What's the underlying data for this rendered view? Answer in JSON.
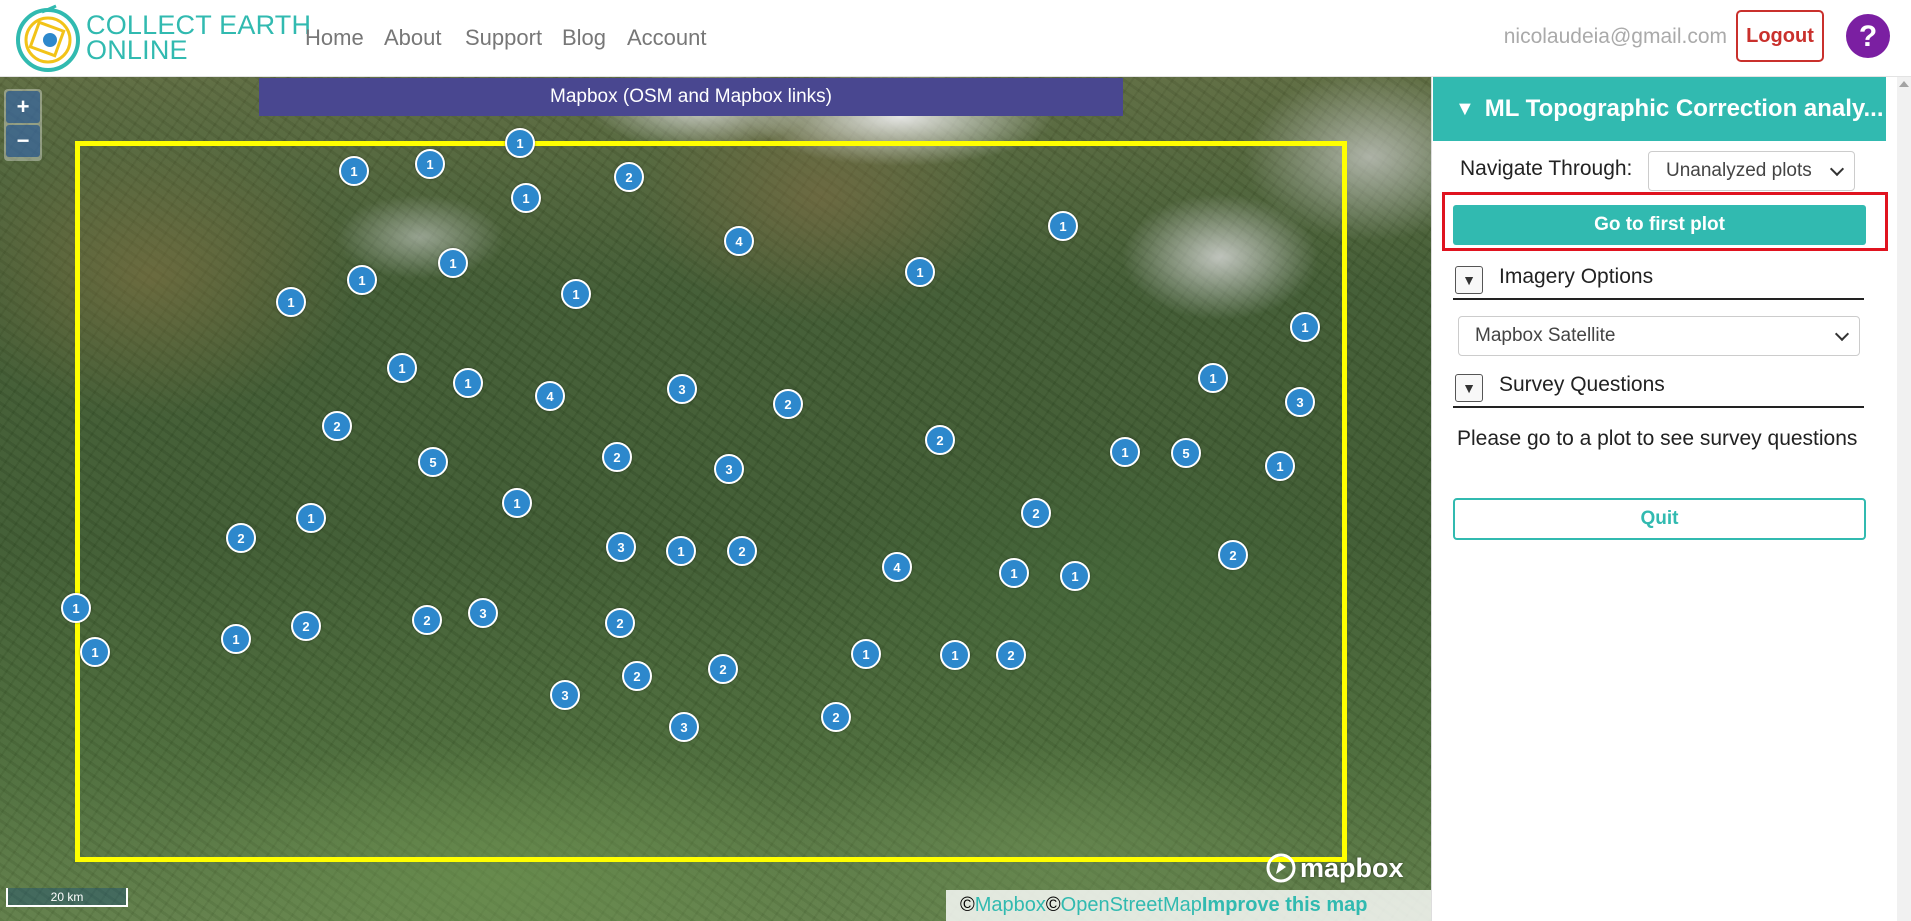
{
  "header": {
    "brand_line1": "COLLECT EARTH",
    "brand_line2": "ONLINE",
    "nav": [
      "Home",
      "About",
      "Support",
      "Blog",
      "Account"
    ],
    "user_email": "nicolaudeia@gmail.com",
    "logout_label": "Logout",
    "help_icon": "question-mark-icon",
    "brand_color": "#31bab0"
  },
  "map": {
    "imagery_title": "Mapbox (OSM and Mapbox links)",
    "zoom_in": "+",
    "zoom_out": "−",
    "scale_label": "20 km",
    "mapbox_logo_text": "mapbox",
    "attribution": {
      "copy1": "© ",
      "link1": "Mapbox",
      "copy2": "© ",
      "link2": "OpenStreetMap",
      "improve": "Improve this map"
    },
    "boundary_color": "#ffff00",
    "cluster_color": "#2d88cc",
    "clusters": [
      "1",
      "1",
      "1",
      "2",
      "1",
      "1",
      "4",
      "1",
      "1",
      "1",
      "1",
      "1",
      "1",
      "1",
      "1",
      "4",
      "3",
      "2",
      "1",
      "3",
      "2",
      "5",
      "2",
      "3",
      "1",
      "2",
      "1",
      "5",
      "1",
      "1",
      "2",
      "2",
      "3",
      "1",
      "2",
      "4",
      "1",
      "1",
      "2",
      "1",
      "1",
      "2",
      "3",
      "2",
      "1",
      "2",
      "1",
      "1",
      "2",
      "2",
      "3",
      "2"
    ]
  },
  "sidebar": {
    "title": "ML Topographic Correction analy...",
    "title_toggle": "▼",
    "navigate_label": "Navigate Through:",
    "navigate_value": "Unanalyzed plots",
    "first_plot_button": "Go to first plot",
    "imagery_section": "Imagery Options",
    "imagery_value": "Mapbox Satellite",
    "survey_section": "Survey Questions",
    "section_toggle": "▼",
    "survey_message": "Please go to a plot to see survey questions",
    "quit_button": "Quit",
    "highlight_color": "#e0131f"
  }
}
